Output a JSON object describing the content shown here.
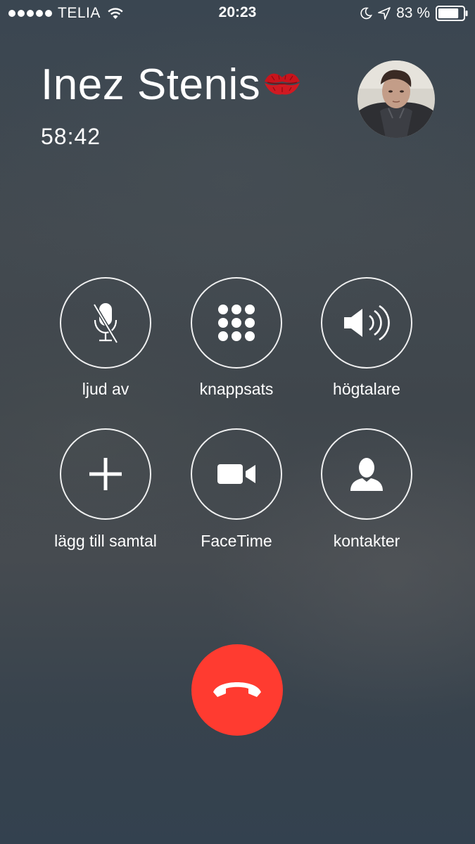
{
  "status_bar": {
    "carrier": "TELIA",
    "time": "20:23",
    "battery_percent": "83 %",
    "battery_level": 0.83,
    "icons": [
      "signal-dots-icon",
      "wifi-icon",
      "moon-icon",
      "location-arrow-icon",
      "battery-icon"
    ]
  },
  "caller": {
    "name": "Inez Stenis",
    "emoji_icon": "kiss-mark-icon",
    "duration": "58:42",
    "avatar_icon": "contact-photo"
  },
  "controls": [
    {
      "label": "ljud av",
      "icon": "mute-microphone-icon"
    },
    {
      "label": "knappsats",
      "icon": "keypad-icon"
    },
    {
      "label": "högtalare",
      "icon": "speaker-icon"
    },
    {
      "label": "lägg till samtal",
      "icon": "plus-icon"
    },
    {
      "label": "FaceTime",
      "icon": "video-camera-icon"
    },
    {
      "label": "kontakter",
      "icon": "contact-person-icon"
    }
  ],
  "end_call": {
    "icon": "hang-up-phone-icon",
    "color": "#ff3b30"
  }
}
